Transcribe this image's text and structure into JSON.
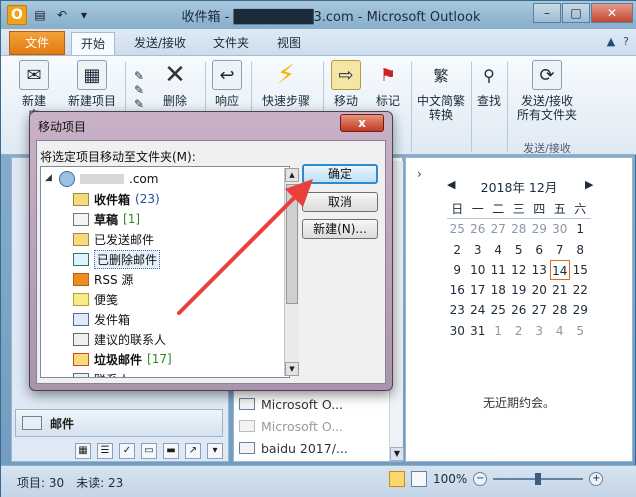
{
  "window": {
    "title": "收件箱 - ████████3.com - Microsoft Outlook",
    "app_icon_letter": "O"
  },
  "ribbon_tabs": [
    "文件",
    "开始",
    "发送/接收",
    "文件夹",
    "视图"
  ],
  "ribbon": {
    "new_email_label": "新建\n电",
    "new_items_label": "新建项目",
    "delete_label": "删除",
    "respond_label": "响应",
    "quick_steps_label": "快速步骤",
    "move_label": "移动",
    "tags_label": "标记",
    "chinese_convert_label": "中文简繁\n转换",
    "find_label": "查找",
    "send_receive_all_label": "发送/接收\n所有文件夹",
    "group_send_receive": "发送/接收"
  },
  "dialog": {
    "title": "移动项目",
    "prompt": "将选定项目移动至文件夹(M):",
    "account_suffix": ".com",
    "folders": [
      {
        "name": "收件箱",
        "count": "(23)",
        "bold": true,
        "count_color": "blue",
        "icon": "inbox"
      },
      {
        "name": "草稿",
        "count": "[1]",
        "bold": true,
        "count_color": "green",
        "icon": "draft"
      },
      {
        "name": "已发送邮件",
        "count": "",
        "bold": false,
        "icon": "sent"
      },
      {
        "name": "已删除邮件",
        "count": "",
        "bold": false,
        "icon": "trash",
        "selected": true
      },
      {
        "name": "RSS 源",
        "count": "",
        "bold": false,
        "icon": "rss"
      },
      {
        "name": "便笺",
        "count": "",
        "bold": false,
        "icon": "note"
      },
      {
        "name": "发件箱",
        "count": "",
        "bold": false,
        "icon": "outbox"
      },
      {
        "name": "建议的联系人",
        "count": "",
        "bold": false,
        "icon": "contact"
      },
      {
        "name": "垃圾邮件",
        "count": "[17]",
        "bold": true,
        "count_color": "green",
        "icon": "junk"
      },
      {
        "name": "联系人",
        "count": "",
        "bold": false,
        "icon": "contact"
      }
    ],
    "buttons": {
      "ok": "确定",
      "cancel": "取消",
      "new": "新建(N)..."
    },
    "close_glyph": "x"
  },
  "navpane": {
    "mail_label": "邮件"
  },
  "messages": [
    {
      "text": "Microsoft O...",
      "muted": false
    },
    {
      "text": "Microsoft O...",
      "muted": true
    },
    {
      "text": "baidu 2017/...",
      "muted": false
    }
  ],
  "calendar": {
    "month_label": "2018年 12月",
    "weekdays": [
      "日",
      "一",
      "二",
      "三",
      "四",
      "五",
      "六"
    ],
    "weeks": [
      [
        "25",
        "26",
        "27",
        "28",
        "29",
        "30",
        "1"
      ],
      [
        "2",
        "3",
        "4",
        "5",
        "6",
        "7",
        "8"
      ],
      [
        "9",
        "10",
        "11",
        "12",
        "13",
        "14",
        "15"
      ],
      [
        "16",
        "17",
        "18",
        "19",
        "20",
        "21",
        "22"
      ],
      [
        "23",
        "24",
        "25",
        "26",
        "27",
        "28",
        "29"
      ],
      [
        "30",
        "31",
        "1",
        "2",
        "3",
        "4",
        "5"
      ]
    ],
    "today": "14",
    "no_appointments": "无近期约会。"
  },
  "statusbar": {
    "items": "项目: 30",
    "unread": "未读: 23",
    "zoom": "100%"
  },
  "colors": {
    "file_tab": "#e27b10",
    "annotation_arrow": "#e8403a",
    "today_border": "#e06a1a"
  }
}
